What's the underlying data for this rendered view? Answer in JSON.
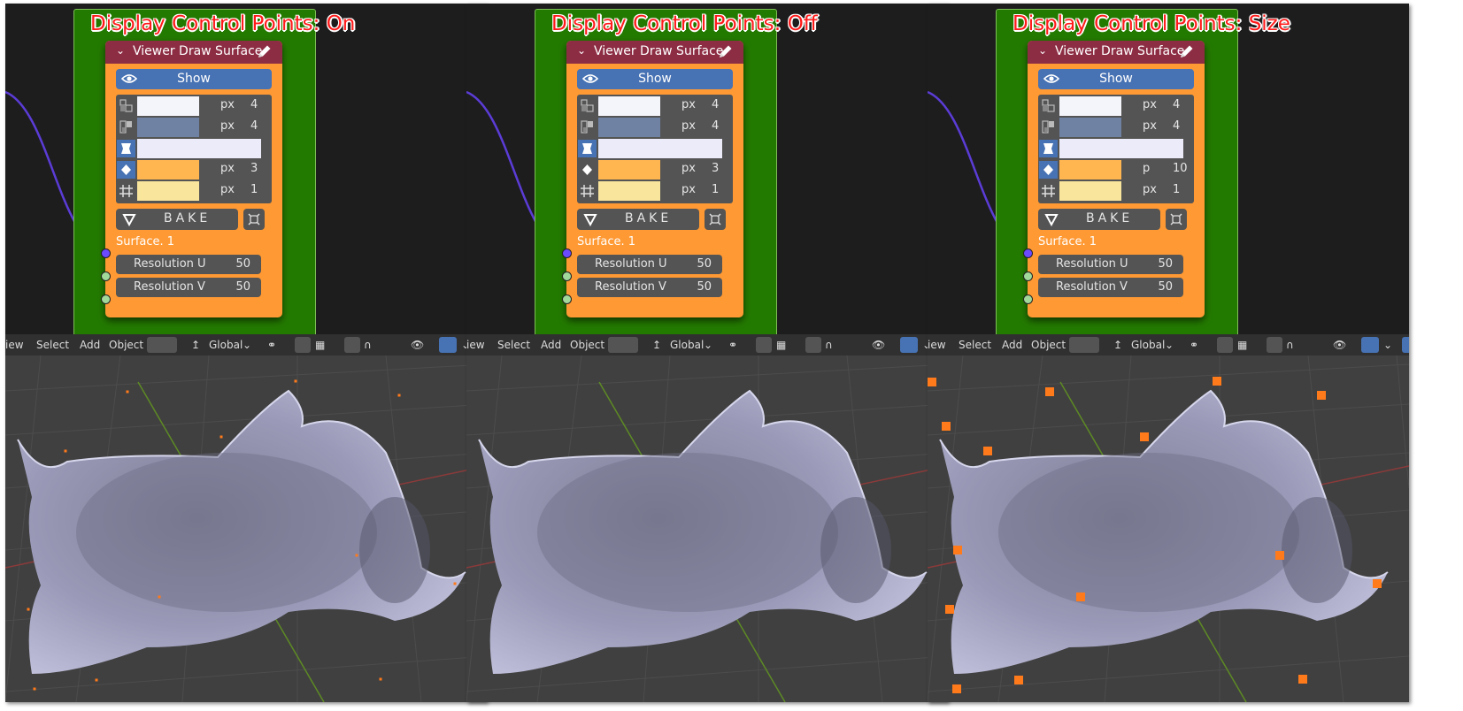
{
  "panels": [
    {
      "label": "Display Control Points: On",
      "node": {
        "title": "Viewer Draw Surface",
        "show_label": "Show",
        "rows": [
          {
            "unit": "px",
            "value": "4",
            "color": "#f4f4fb"
          },
          {
            "unit": "px",
            "value": "4",
            "color": "#6f82a4"
          },
          {
            "unit": "",
            "value": "",
            "color": "#ebebf9"
          },
          {
            "unit": "px",
            "value": "3",
            "color": "#ffb550"
          },
          {
            "unit": "px",
            "value": "1",
            "color": "#f9e59b"
          }
        ],
        "bake_label": "BAKE",
        "surface_socket": "Surface. 1",
        "resolution_u": {
          "label": "Resolution U",
          "value": "50"
        },
        "resolution_v": {
          "label": "Resolution V",
          "value": "50"
        },
        "vertex_icon_active": true
      },
      "control_points": "small"
    },
    {
      "label": "Display Control Points: Off",
      "node": {
        "title": "Viewer Draw Surface",
        "show_label": "Show",
        "rows": [
          {
            "unit": "px",
            "value": "4",
            "color": "#f4f4fb"
          },
          {
            "unit": "px",
            "value": "4",
            "color": "#6f82a4"
          },
          {
            "unit": "",
            "value": "",
            "color": "#ebebf9"
          },
          {
            "unit": "px",
            "value": "3",
            "color": "#ffb550"
          },
          {
            "unit": "px",
            "value": "1",
            "color": "#f9e59b"
          }
        ],
        "bake_label": "BAKE",
        "surface_socket": "Surface. 1",
        "resolution_u": {
          "label": "Resolution U",
          "value": "50"
        },
        "resolution_v": {
          "label": "Resolution V",
          "value": "50"
        },
        "vertex_icon_active": false
      },
      "control_points": "none"
    },
    {
      "label": "Display Control Points: Size",
      "node": {
        "title": "Viewer Draw Surface",
        "show_label": "Show",
        "rows": [
          {
            "unit": "px",
            "value": "4",
            "color": "#f4f4fb"
          },
          {
            "unit": "px",
            "value": "4",
            "color": "#6f82a4"
          },
          {
            "unit": "",
            "value": "",
            "color": "#ebebf9"
          },
          {
            "unit": "p",
            "value": "10",
            "color": "#ffb550"
          },
          {
            "unit": "px",
            "value": "1",
            "color": "#f9e59b"
          }
        ],
        "bake_label": "BAKE",
        "surface_socket": "Surface. 1",
        "resolution_u": {
          "label": "Resolution U",
          "value": "50"
        },
        "resolution_v": {
          "label": "Resolution V",
          "value": "50"
        },
        "vertex_icon_active": true
      },
      "control_points": "large"
    }
  ],
  "viewport_header": {
    "view": "iew",
    "select": "Select",
    "add": "Add",
    "object": "Object",
    "orientation": "Global"
  },
  "colors": {
    "frame": "#237a00",
    "node_body": "#ff9933",
    "node_header": "#8d2d44",
    "button_blue": "#4772b3",
    "label_red": "#ff1a1a",
    "surface": "#a9a9c9",
    "control_point": "#ff7a1a",
    "wire": "#5b3cd6"
  }
}
